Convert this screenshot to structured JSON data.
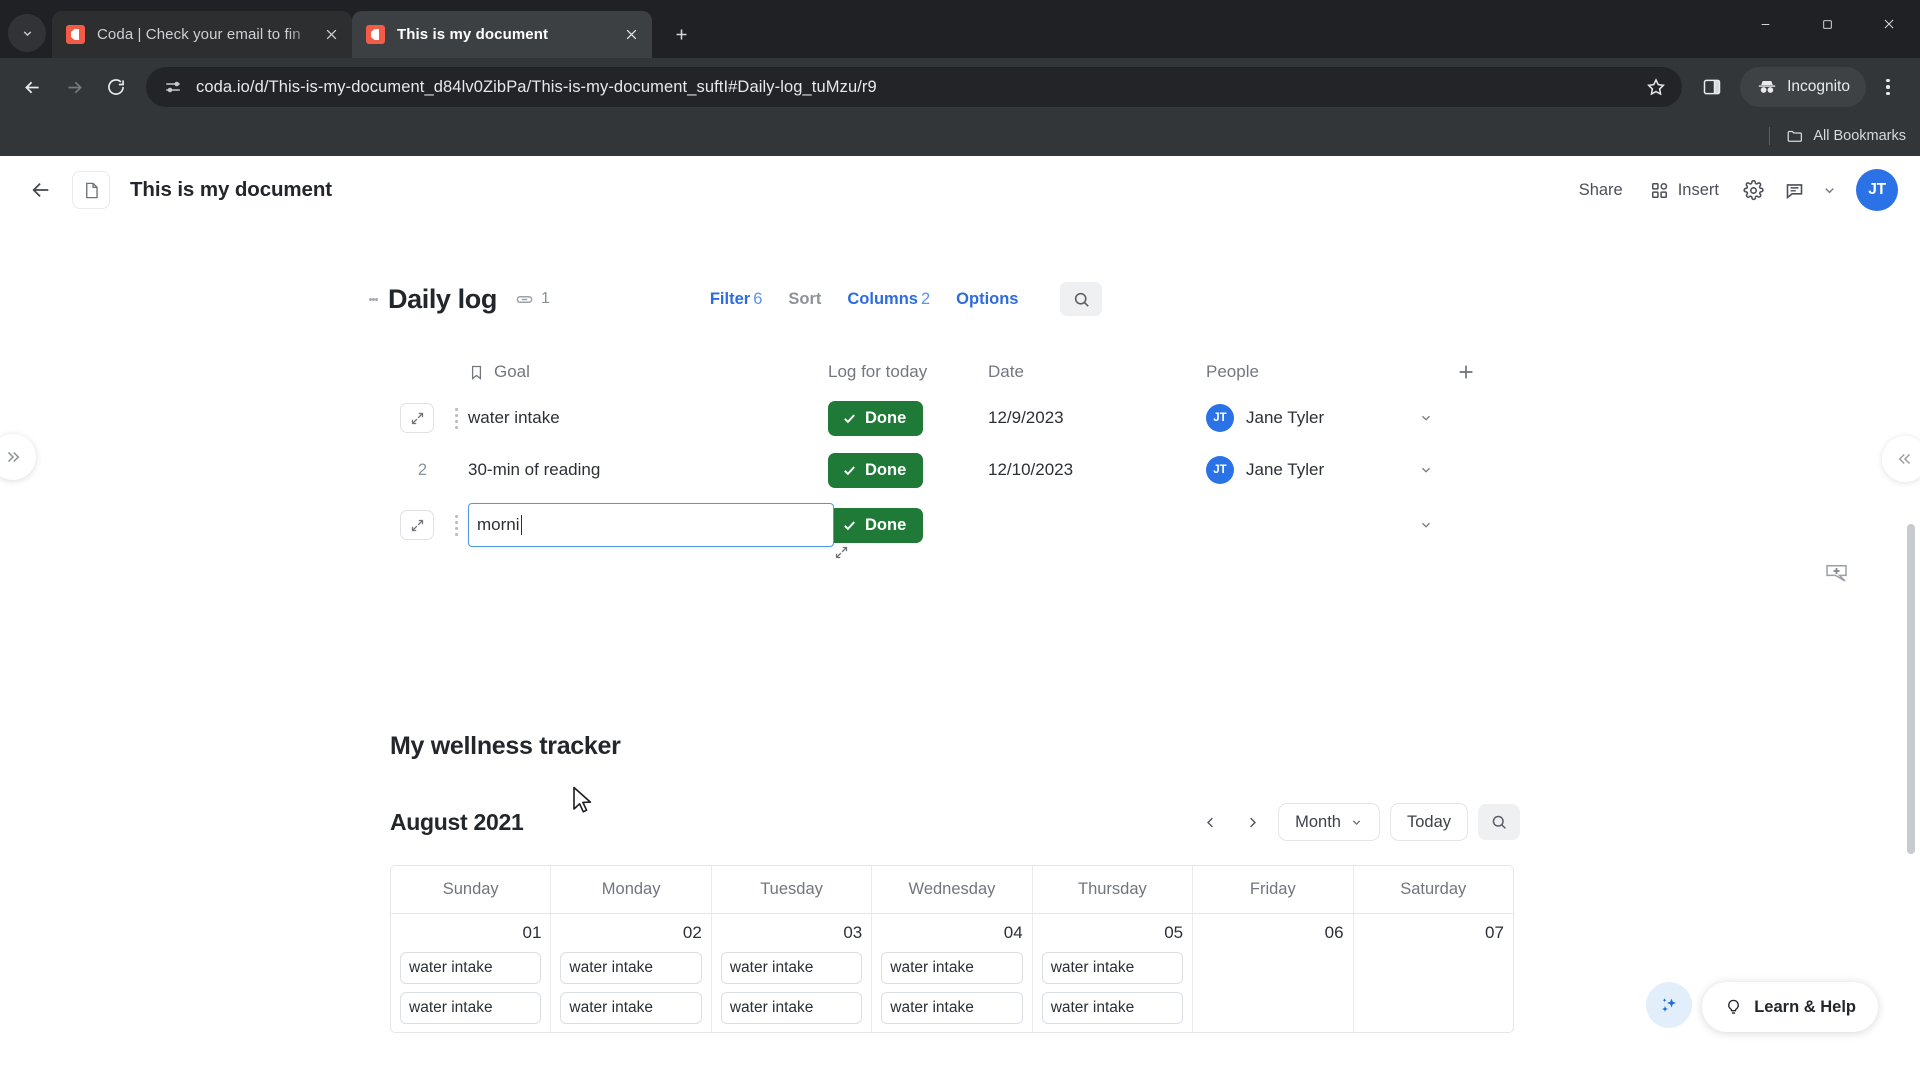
{
  "browser": {
    "tabs": [
      {
        "title": "Coda | Check your email to fin",
        "active": false,
        "favicon": "coda-icon"
      },
      {
        "title": "This is my document",
        "active": true,
        "favicon": "coda-icon"
      }
    ],
    "new_tab_label": "+",
    "tab_search_icon": "chevron-down-icon",
    "window_controls": {
      "minimize": "–",
      "maximize": "□",
      "close": "✕"
    },
    "nav": {
      "back": "←",
      "forward": "→",
      "reload": "↻"
    },
    "omnibox": {
      "url": "coda.io/d/This-is-my-document_d84lv0ZibPa/This-is-my-document_suftI#Daily-log_tuMzu/r9",
      "site_info_icon": "site-settings-icon",
      "bookmark_icon": "star-icon",
      "sidepanel_icon": "side-panel-icon"
    },
    "incognito_label": "Incognito",
    "bookmarks_bar": {
      "label": "All Bookmarks",
      "icon": "folder-icon"
    }
  },
  "doc_header": {
    "back_icon": "arrow-left-icon",
    "doc_icon": "document-icon",
    "title": "This is my document",
    "share_label": "Share",
    "insert_label": "Insert",
    "insert_icon": "grid-add-icon",
    "settings_icon": "gear-icon",
    "comment_icon": "comment-icon",
    "caret_icon": "chevron-down-icon",
    "avatar_initials": "JT"
  },
  "sidebar": {
    "expand_left_icon": "chevron-double-right-icon",
    "collapse_right_icon": "chevron-double-left-icon"
  },
  "table": {
    "name": "Daily log",
    "link_icon": "link-icon",
    "link_count": "1",
    "actions": {
      "filter_label": "Filter",
      "filter_count": "6",
      "sort_label": "Sort",
      "columns_label": "Columns",
      "columns_count": "2",
      "options_label": "Options",
      "search_icon": "search-icon"
    },
    "columns": [
      {
        "label": "Goal",
        "icon": "bookmark-icon"
      },
      {
        "label": "Log for today",
        "icon": ""
      },
      {
        "label": "Date",
        "icon": ""
      },
      {
        "label": "People",
        "icon": ""
      }
    ],
    "add_column_icon": "plus-icon",
    "rows": [
      {
        "row_marker": "expand",
        "goal": "water intake",
        "log_for_today": "Done",
        "date": "12/9/2023",
        "person": "Jane Tyler",
        "person_initials": "JT",
        "editing": false
      },
      {
        "row_marker": "2",
        "goal": "30-min of reading",
        "log_for_today": "Done",
        "date": "12/10/2023",
        "person": "Jane Tyler",
        "person_initials": "JT",
        "editing": false
      },
      {
        "row_marker": "expand",
        "goal": "morni",
        "log_for_today": "Done",
        "date": "",
        "person": "",
        "person_initials": "",
        "editing": true
      }
    ],
    "chip_done_color": "#1f7a38",
    "check_icon": "check-icon"
  },
  "wellness": {
    "title": "My wellness tracker",
    "calendar": {
      "month_label": "August 2021",
      "prev_icon": "chevron-left-icon",
      "next_icon": "chevron-right-icon",
      "view_label": "Month",
      "view_caret_icon": "chevron-down-icon",
      "today_label": "Today",
      "search_icon": "search-icon",
      "weekdays": [
        "Sunday",
        "Monday",
        "Tuesday",
        "Wednesday",
        "Thursday",
        "Friday",
        "Saturday"
      ],
      "weeks": [
        {
          "days": [
            {
              "num": "01",
              "events": [
                "water intake",
                "water intake"
              ]
            },
            {
              "num": "02",
              "events": [
                "water intake",
                "water intake"
              ]
            },
            {
              "num": "03",
              "events": [
                "water intake",
                "water intake"
              ]
            },
            {
              "num": "04",
              "events": [
                "water intake",
                "water intake"
              ]
            },
            {
              "num": "05",
              "events": [
                "water intake",
                "water intake"
              ]
            },
            {
              "num": "06",
              "events": []
            },
            {
              "num": "07",
              "events": []
            }
          ]
        }
      ]
    }
  },
  "floating": {
    "comment_add_icon": "add-comment-icon",
    "ai_icon": "sparkles-icon",
    "help_label": "Learn & Help",
    "help_icon": "lightbulb-icon"
  },
  "colors": {
    "accent_blue": "#2d6cdf",
    "done_green": "#1f7a38",
    "avatar_blue": "#2a72e5",
    "coda_red": "#f25c46"
  }
}
